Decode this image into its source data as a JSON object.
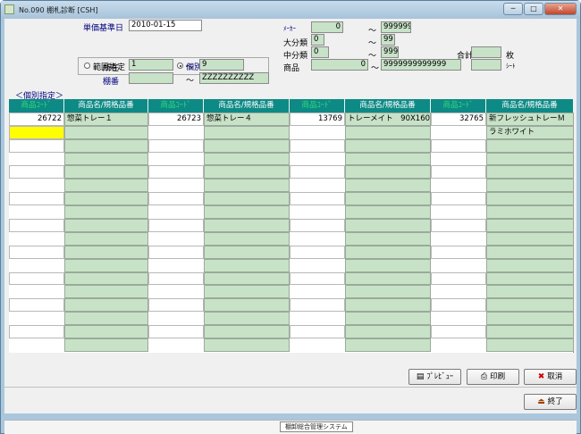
{
  "window": {
    "title": "No.090 棚札診断 [CSH]",
    "minimize": "─",
    "maximize": "□",
    "close": "✕"
  },
  "header": {
    "base_date_label": "単価基準日",
    "base_date_value": "2010-01-15",
    "range_radio_label": "範囲指定",
    "individual_radio_label": "個別指定",
    "location_label": "所在",
    "location_from": "1",
    "location_tilde": "〜",
    "location_to": "9",
    "shelf_label": "棚番",
    "shelf_from": "",
    "shelf_tilde": "〜",
    "shelf_to": "ZZZZZZZZZZ",
    "maker_label": "ﾒｰｶｰ",
    "maker_from": "0",
    "maker_tilde": "〜",
    "maker_to": "999999",
    "cat_large_label": "大分類",
    "cat_large_from": "0",
    "cat_large_tilde": "〜",
    "cat_large_to": "99",
    "cat_mid_label": "中分類",
    "cat_mid_from": "0",
    "cat_mid_tilde": "〜",
    "cat_mid_to": "999",
    "product_label": "商品",
    "product_from": "0",
    "product_tilde": "〜",
    "product_to": "9999999999999",
    "total_label": "合計",
    "total_value": "",
    "sheets_unit": "枚",
    "sheet_value": "",
    "sheet_unit": "ｼｰﾄ"
  },
  "section_label": "＜個別指定＞",
  "grid": {
    "headers": [
      "商品ｺｰﾄﾞ",
      "商品名/規格品番",
      "商品ｺｰﾄﾞ",
      "商品名/規格品番",
      "商品ｺｰﾄﾞ",
      "商品名/規格品番",
      "商品ｺｰﾄﾞ",
      "商品名/規格品番"
    ],
    "rows": [
      [
        "26722",
        "惣菜トレー１",
        "26723",
        "惣菜トレー４",
        "13769",
        "トレーメイト　90X160",
        "32765",
        "新フレッシュトレーＭ"
      ],
      [
        "",
        "",
        "",
        "",
        "",
        "",
        "",
        "ラミホワイト"
      ]
    ]
  },
  "buttons": {
    "preview": "ﾌﾟﾚﾋﾞｭｰ",
    "print": "印刷",
    "cancel": "取消",
    "exit": "終了"
  },
  "status": {
    "tab_text": "棚卸総合管理システム"
  },
  "colors": {
    "header_bg": "#0e8a86",
    "code_header_text": "#2fdc78",
    "field_bg": "#c8e2c8",
    "active_cell": "#ffff00"
  }
}
